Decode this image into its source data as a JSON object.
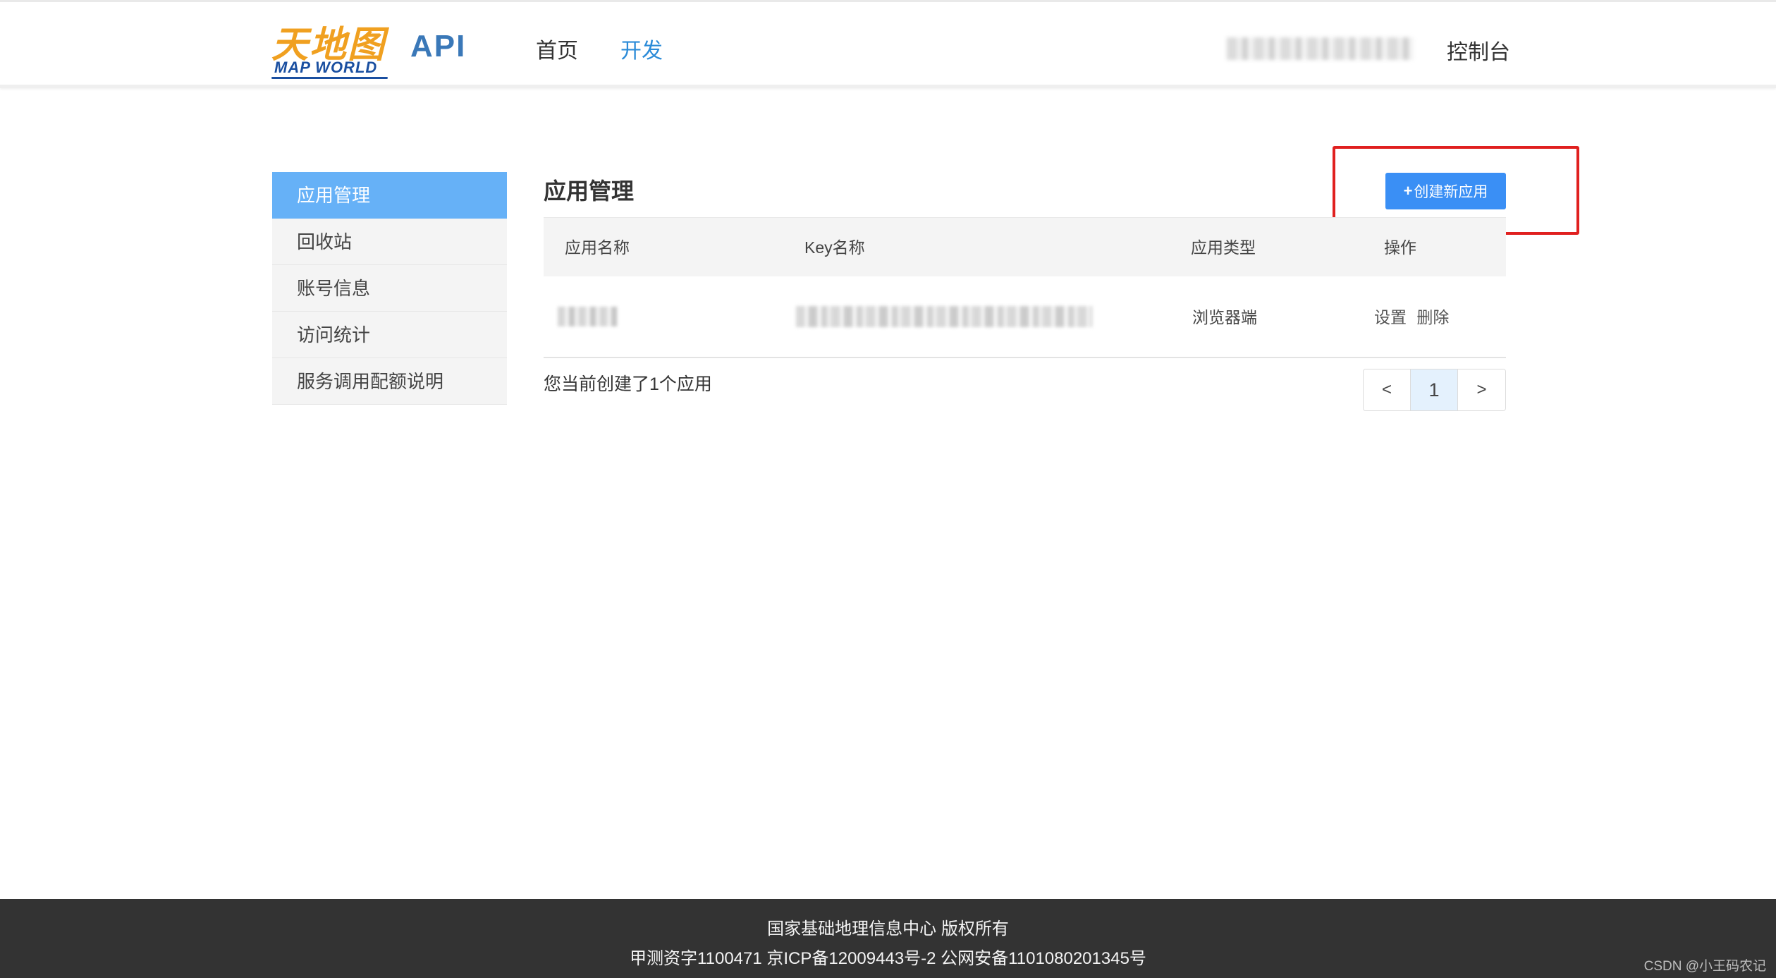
{
  "header": {
    "logo_cn": "天地图",
    "logo_en": "MAP WORLD",
    "api_label": "API",
    "nav": [
      {
        "label": "首页"
      },
      {
        "label": "开发"
      }
    ],
    "console_label": "控制台"
  },
  "sidebar": {
    "items": [
      {
        "label": "应用管理",
        "active": true
      },
      {
        "label": "回收站"
      },
      {
        "label": "账号信息"
      },
      {
        "label": "访问统计"
      },
      {
        "label": "服务调用配额说明"
      }
    ]
  },
  "main": {
    "title": "应用管理",
    "create_button": {
      "plus": "+",
      "label": "创建新应用"
    },
    "table": {
      "headers": [
        "应用名称",
        "Key名称",
        "应用类型",
        "操作"
      ],
      "rows": [
        {
          "app_type": "浏览器端",
          "actions": [
            "设置",
            "删除"
          ]
        }
      ]
    },
    "summary": "您当前创建了1个应用",
    "pager": {
      "prev": "<",
      "current": "1",
      "next": ">"
    }
  },
  "footer": {
    "line1": "国家基础地理信息中心  版权所有",
    "line2": "甲测资字1100471  京ICP备12009443号-2  公网安备1101080201345号",
    "watermark": "CSDN @小王码农记"
  },
  "colors": {
    "accent": "#3a8ff5",
    "nav_active": "#2b8bd8",
    "sidebar_active": "#66b1f7",
    "highlight": "#e0201f",
    "footer_bg": "#333333"
  }
}
